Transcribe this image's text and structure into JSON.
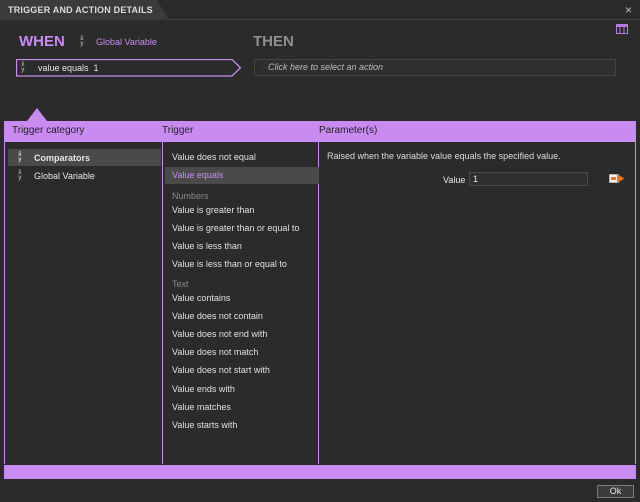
{
  "window": {
    "title": "TRIGGER AND ACTION DETAILS",
    "close_glyph": "×"
  },
  "when": {
    "label": "WHEN",
    "variable_link": "Global Variable",
    "selected_trigger": "value equals",
    "selected_value": "1"
  },
  "then": {
    "label": "THEN",
    "placeholder": "Click here to select an action"
  },
  "headers": {
    "category": "Trigger category",
    "trigger": "Trigger",
    "parameters": "Parameter(s)"
  },
  "categories": [
    {
      "label": "Comparators",
      "icon": "variable-icon",
      "selected": true
    },
    {
      "label": "Global Variable",
      "icon": "variable-icon",
      "selected": false
    }
  ],
  "triggers": {
    "top": [
      "Value does not equal",
      "Value equals"
    ],
    "selected": "Value equals",
    "numbers_label": "Numbers",
    "numbers": [
      "Value is greater than",
      "Value is greater than or equal to",
      "Value is less than",
      "Value is less than or equal to"
    ],
    "text_label": "Text",
    "text": [
      "Value contains",
      "Value does not contain",
      "Value does not end with",
      "Value does not match",
      "Value does not start with",
      "Value ends with",
      "Value matches",
      "Value starts with"
    ]
  },
  "parameters": {
    "description": "Raised when the variable value equals the specified value.",
    "value_label": "Value",
    "value": "1"
  },
  "footer": {
    "ok_label": "Ok"
  },
  "colors": {
    "accent": "#c98bf2",
    "background": "#2b2b2b",
    "selected_row": "#4a4a4a",
    "then_label": "#8f8f8f"
  }
}
